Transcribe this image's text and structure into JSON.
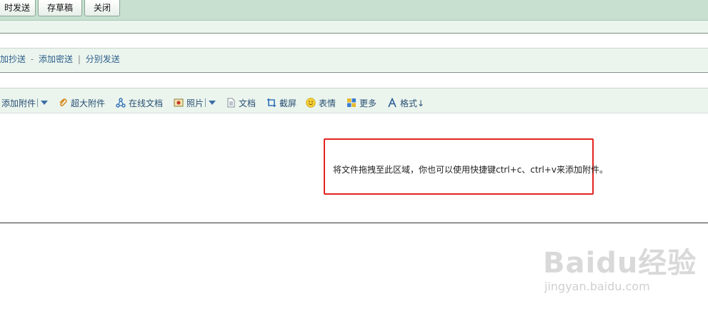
{
  "toolbar": {
    "send_label": "时发送",
    "draft_label": "存草稿",
    "close_label": "关闭"
  },
  "recipients": {
    "add_cc": "加抄送",
    "dash": "-",
    "add_bcc": "添加密送",
    "divider": "|",
    "separate_send": "分别发送"
  },
  "attach_toolbar": {
    "add_attachment": "添加附件",
    "large_attachment": "超大附件",
    "online_docs": "在线文档",
    "photo": "照片",
    "document": "文档",
    "screenshot": "截屏",
    "emoji": "表情",
    "more": "更多",
    "format": "格式↓"
  },
  "dropzone": {
    "hint": "将文件拖拽至此区域，你也可以使用快捷键ctrl+c、ctrl+v来添加附件。"
  },
  "watermark": {
    "logo": "Baidu经验",
    "url": "jingyan.baidu.com"
  },
  "colors": {
    "toolbar_bg": "#c7e0cf",
    "strip_bg": "#ebf5ee",
    "link": "#2d5f8a",
    "highlight_box": "#e3251f"
  },
  "icons": [
    "paperclip-icon",
    "share-nodes-icon",
    "photo-icon",
    "document-icon",
    "screenshot-icon",
    "smiley-icon",
    "grid-icon",
    "font-a-icon",
    "chevron-down-icon"
  ]
}
